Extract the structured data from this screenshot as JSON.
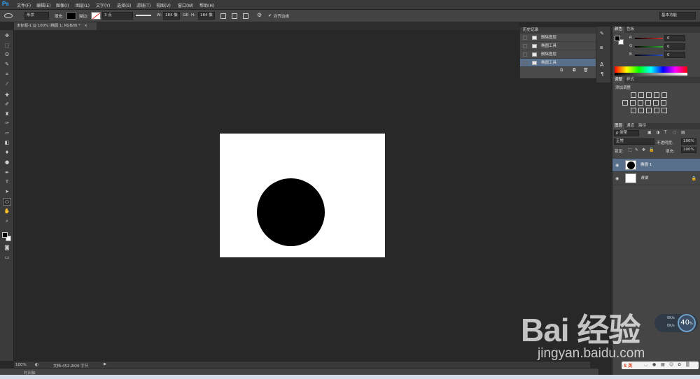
{
  "app": {
    "logo": "Ps"
  },
  "menu": [
    "文件(F)",
    "编辑(E)",
    "图像(I)",
    "图层(L)",
    "文字(Y)",
    "选择(S)",
    "滤镜(T)",
    "视图(V)",
    "窗口(W)",
    "帮助(H)"
  ],
  "options_bar": {
    "mode": "形状",
    "fill_label": "填充:",
    "stroke_label": "描边:",
    "stroke_size": "3 点",
    "w_label": "W:",
    "w_value": "184 像",
    "link_icon": "GĐ",
    "h_label": "H:",
    "h_value": "184 像",
    "align_edges": "对齐边缘",
    "workspace": "基本功能"
  },
  "document_tab": {
    "title": "未标题-1 @ 100% (椭圆 1, RGB/8) *"
  },
  "history_panel": {
    "tabs": [
      "历史记录"
    ],
    "items": [
      {
        "label": "删除图层",
        "selected": false
      },
      {
        "label": "椭圆工具",
        "selected": false
      },
      {
        "label": "删除图层",
        "selected": false
      },
      {
        "label": "椭圆工具",
        "selected": true
      }
    ]
  },
  "color_panel": {
    "tabs": [
      "颜色",
      "色板"
    ],
    "channels": [
      {
        "label": "R",
        "value": "0",
        "color": "#d03030"
      },
      {
        "label": "G",
        "value": "0",
        "color": "#30b030"
      },
      {
        "label": "B",
        "value": "0",
        "color": "#3050d0"
      }
    ]
  },
  "adjustments_panel": {
    "tabs": [
      "调整",
      "样式"
    ],
    "title": "添加调整"
  },
  "layers_panel": {
    "tabs": [
      "图层",
      "通道",
      "路径"
    ],
    "filter": "ρ 类型",
    "blend_mode": "正常",
    "opacity_label": "不透明度:",
    "opacity_value": "100%",
    "lock_label": "锁定:",
    "fill_label": "填充:",
    "fill_value": "100%",
    "layers": [
      {
        "name": "椭圆 1",
        "selected": true
      },
      {
        "name": "背景",
        "selected": false
      }
    ]
  },
  "status_bar": {
    "zoom": "100%",
    "doc_info": "文档:452.2K/0 字节"
  },
  "timeline": {
    "label": "时间轴"
  },
  "watermark": {
    "logo": "Bai 经验",
    "url": "jingyan.baidu.com"
  },
  "meter": {
    "value": "40",
    "unit": "%",
    "up": "0K/s",
    "down": "0K/s"
  },
  "ime": {
    "label": "S 英"
  }
}
